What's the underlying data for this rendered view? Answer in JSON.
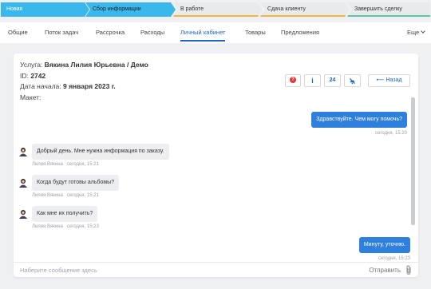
{
  "pipeline": {
    "stages": [
      {
        "label": "Новая"
      },
      {
        "label": "Сбор информации"
      },
      {
        "label": "В работе"
      },
      {
        "label": "Сдача клиенту"
      },
      {
        "label": "Завершить сделку"
      }
    ]
  },
  "tabs": {
    "items": [
      "Общие",
      "Поток задач",
      "Рассрочка",
      "Расходы",
      "Личный кабинет",
      "Товары",
      "Предложения"
    ],
    "active": "Личный кабинет",
    "more_label": "Еще"
  },
  "deal": {
    "service_label": "Услуга:",
    "service_value": "Вякина Лилия Юрьевна / Демо",
    "id_label": "ID:",
    "id_value": "2742",
    "start_label": "Дата начала:",
    "start_value": "9 января 2023 г.",
    "layout_label": "Макет:"
  },
  "toolbar": {
    "alert_glyph": "?",
    "info_glyph": "i",
    "hours_label": "24",
    "back_label": "Назад"
  },
  "chat": {
    "messages": [
      {
        "dir": "out",
        "text": "Здравствуйте. Чем могу помочь?",
        "meta": "сегодня, 15:20"
      },
      {
        "dir": "in",
        "text": "Добрый день. Мне нужна информация по заказу.",
        "author": "Лилия Вякина",
        "meta": "сегодня, 15:21"
      },
      {
        "dir": "in",
        "text": "Когда будут готовы альбомы?",
        "author": "Лилия Вякина",
        "meta": "сегодня, 15:21"
      },
      {
        "dir": "in",
        "text": "Как мне их получить?",
        "author": "Лилия Вякина",
        "meta": "сегодня, 15:23"
      },
      {
        "dir": "out",
        "text": "Минуту, уточню.",
        "meta": "сегодня, 15:23"
      }
    ]
  },
  "composer": {
    "placeholder": "Наберите сообщение здесь",
    "send_label": "Отправить"
  },
  "colors": {
    "accent": "#2065c0",
    "stage_active": "#3ab8ec",
    "bubble_out": "#2f80dc",
    "bubble_in": "#eceef1",
    "alert": "#e53935"
  }
}
